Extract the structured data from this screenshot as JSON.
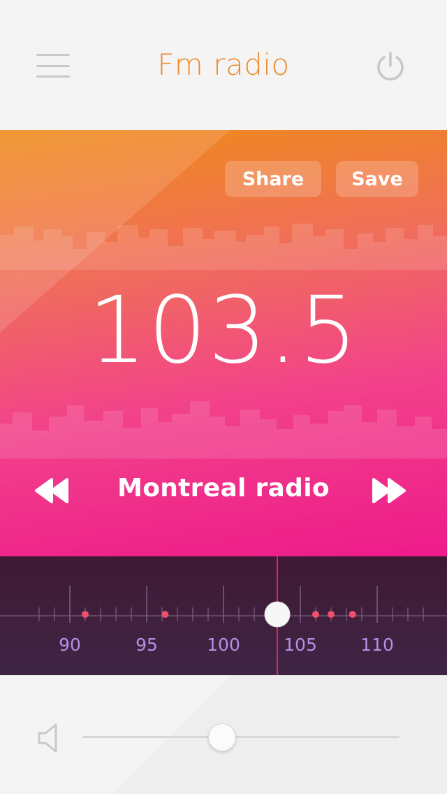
{
  "header": {
    "title": "Fm radio",
    "menu_icon": "hamburger-menu-icon",
    "power_icon": "power-icon"
  },
  "hero": {
    "share_label": "Share",
    "save_label": "Save",
    "frequency": "103.5",
    "station_name": "Montreal radio",
    "rewind_icon": "rewind-icon",
    "forward_icon": "fast-forward-icon"
  },
  "tuner": {
    "min_freq": 88,
    "max_freq": 113,
    "current_freq": 103.5,
    "labels": [
      "90",
      "95",
      "100",
      "105",
      "110"
    ],
    "label_values": [
      90,
      95,
      100,
      105,
      110
    ],
    "saved_stations": [
      91,
      96.2,
      106,
      107,
      108.4
    ]
  },
  "volume": {
    "speaker_icon": "speaker-icon",
    "level": 0.44
  },
  "colors": {
    "accent_orange": "#ee8a2b",
    "hero_top": "#ef8b17",
    "hero_bottom": "#ee1a8a",
    "tuner_bg": "#3f1934",
    "tuner_label": "#b48fe4",
    "station_dot": "#f04e6e",
    "needle": "#d8266b"
  }
}
